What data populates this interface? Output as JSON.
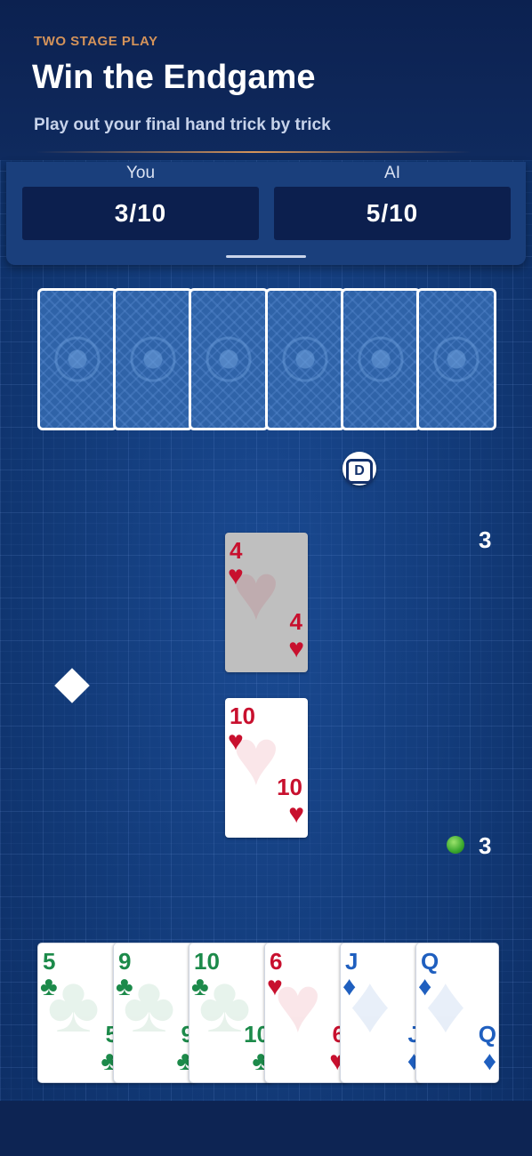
{
  "header": {
    "eyebrow": "TWO STAGE PLAY",
    "title": "Win the Endgame",
    "subtitle": "Play out your final hand trick by trick"
  },
  "scores": {
    "you": {
      "label": "You",
      "value": "3/10"
    },
    "ai": {
      "label": "AI",
      "value": "5/10"
    }
  },
  "opponent": {
    "cards_in_hand": 6,
    "tricks_won": "3"
  },
  "dealer_chip": "D",
  "trump_suit_icon": "diamond-icon",
  "player": {
    "tricks_won": "3",
    "status_dot_color": "#3aa82e"
  },
  "trick": [
    {
      "rank": "4",
      "suit": "♥",
      "color": "red",
      "played_by": "AI"
    },
    {
      "rank": "10",
      "suit": "♥",
      "color": "red",
      "played_by": "You"
    }
  ],
  "hand": [
    {
      "rank": "5",
      "suit": "♣",
      "color": "green"
    },
    {
      "rank": "9",
      "suit": "♣",
      "color": "green"
    },
    {
      "rank": "10",
      "suit": "♣",
      "color": "green"
    },
    {
      "rank": "6",
      "suit": "♥",
      "color": "red"
    },
    {
      "rank": "J",
      "suit": "♦",
      "color": "blue"
    },
    {
      "rank": "Q",
      "suit": "♦",
      "color": "blue"
    }
  ],
  "colors": {
    "accent": "#d4935a",
    "table": "#123a78",
    "hearts": "#c8102e",
    "clubs": "#1c8a4a",
    "diamonds": "#1f5fbf"
  }
}
